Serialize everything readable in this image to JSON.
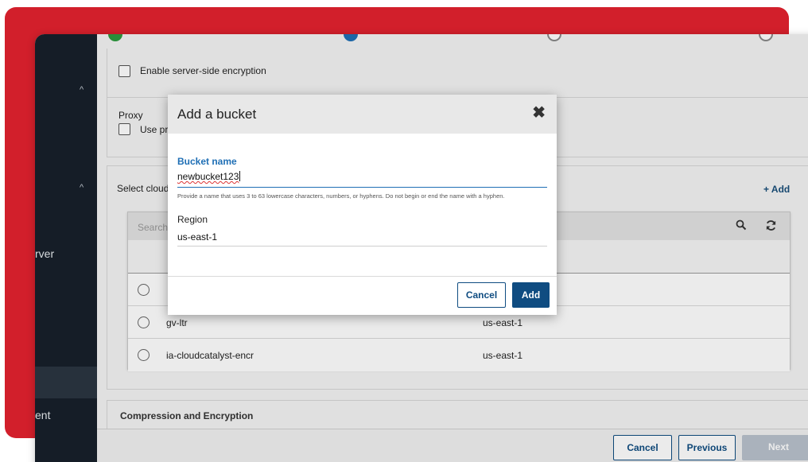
{
  "sidebar": {
    "items": [
      {
        "label": "rver"
      },
      {
        "label": "ent"
      }
    ]
  },
  "encryption": {
    "enable_sse_label": "Enable server-side encryption"
  },
  "proxy": {
    "title": "Proxy",
    "use_label": "Use pro"
  },
  "cloud": {
    "select_label": "Select cloud",
    "add_label": "+ Add",
    "search_placeholder": "Search...",
    "rows": [
      {
        "name": "",
        "region": ""
      },
      {
        "name": "gv-ltr",
        "region": "us-east-1"
      },
      {
        "name": "ia-cloudcatalyst-encr",
        "region": "us-east-1"
      }
    ]
  },
  "compression": {
    "title": "Compression and Encryption"
  },
  "footer": {
    "cancel": "Cancel",
    "previous": "Previous",
    "next": "Next"
  },
  "modal": {
    "title": "Add a bucket",
    "bucket_name_label": "Bucket name",
    "bucket_name_value": "newbucket123",
    "hint": "Provide a name that uses 3 to 63 lowercase characters, numbers, or hyphens. Do not begin or end the name with a hyphen.",
    "region_label": "Region",
    "region_value": "us-east-1",
    "cancel": "Cancel",
    "add": "Add"
  },
  "colors": {
    "brand_red": "#d21f2b",
    "primary_blue": "#0f4c81",
    "sidebar_bg": "#17202b",
    "label_blue": "#1f6fb5"
  },
  "icons": [
    "close-icon",
    "search-icon",
    "refresh-icon",
    "chevron-up-icon",
    "checkbox-icon",
    "radio-icon"
  ]
}
